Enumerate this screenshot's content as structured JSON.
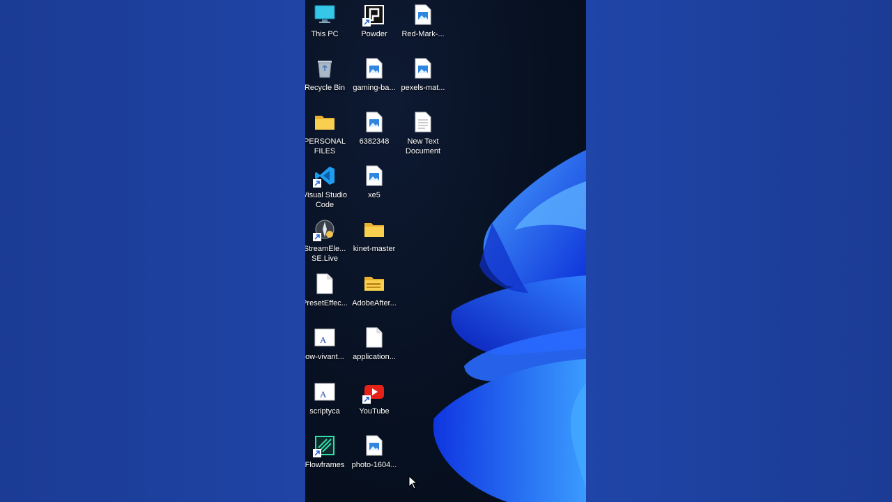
{
  "desktop_icons": [
    {
      "label": "This PC",
      "icon": "monitor-icon"
    },
    {
      "label": "Powder",
      "icon": "powder-app-icon"
    },
    {
      "label": "Red-Mark-...",
      "icon": "image-file-icon"
    },
    {
      "label": "Recycle Bin",
      "icon": "recycle-bin-icon"
    },
    {
      "label": "gaming-ba...",
      "icon": "image-file-icon"
    },
    {
      "label": "pexels-mat...",
      "icon": "image-file-icon"
    },
    {
      "label": "PERSONAL FILES",
      "icon": "folder-icon"
    },
    {
      "label": "6382348",
      "icon": "image-file-icon"
    },
    {
      "label": "New Text Document",
      "icon": "text-file-icon"
    },
    {
      "label": "Visual Studio Code",
      "icon": "vscode-icon"
    },
    {
      "label": "xe5",
      "icon": "image-file-icon"
    },
    {
      "label": "StreamEle... SE.Live",
      "icon": "streamelements-icon"
    },
    {
      "label": "kinet-master",
      "icon": "folder-icon"
    },
    {
      "label": "PresetEffec...",
      "icon": "blank-file-icon"
    },
    {
      "label": "AdobeAfter...",
      "icon": "zip-folder-icon"
    },
    {
      "label": "ow-vivant...",
      "icon": "font-file-icon"
    },
    {
      "label": "application...",
      "icon": "blank-file-icon"
    },
    {
      "label": "scriptyca",
      "icon": "font-file-icon"
    },
    {
      "label": "YouTube",
      "icon": "youtube-icon"
    },
    {
      "label": "Flowframes",
      "icon": "flowframes-icon"
    },
    {
      "label": "photo-1604...",
      "icon": "image-file-icon"
    }
  ],
  "colors": {
    "desktop_background": "#071020",
    "bloom_blue": "#1d52f2",
    "side_blur": "#1b3b94",
    "folder_yellow": "#f5c842",
    "youtube_red": "#e62117"
  }
}
